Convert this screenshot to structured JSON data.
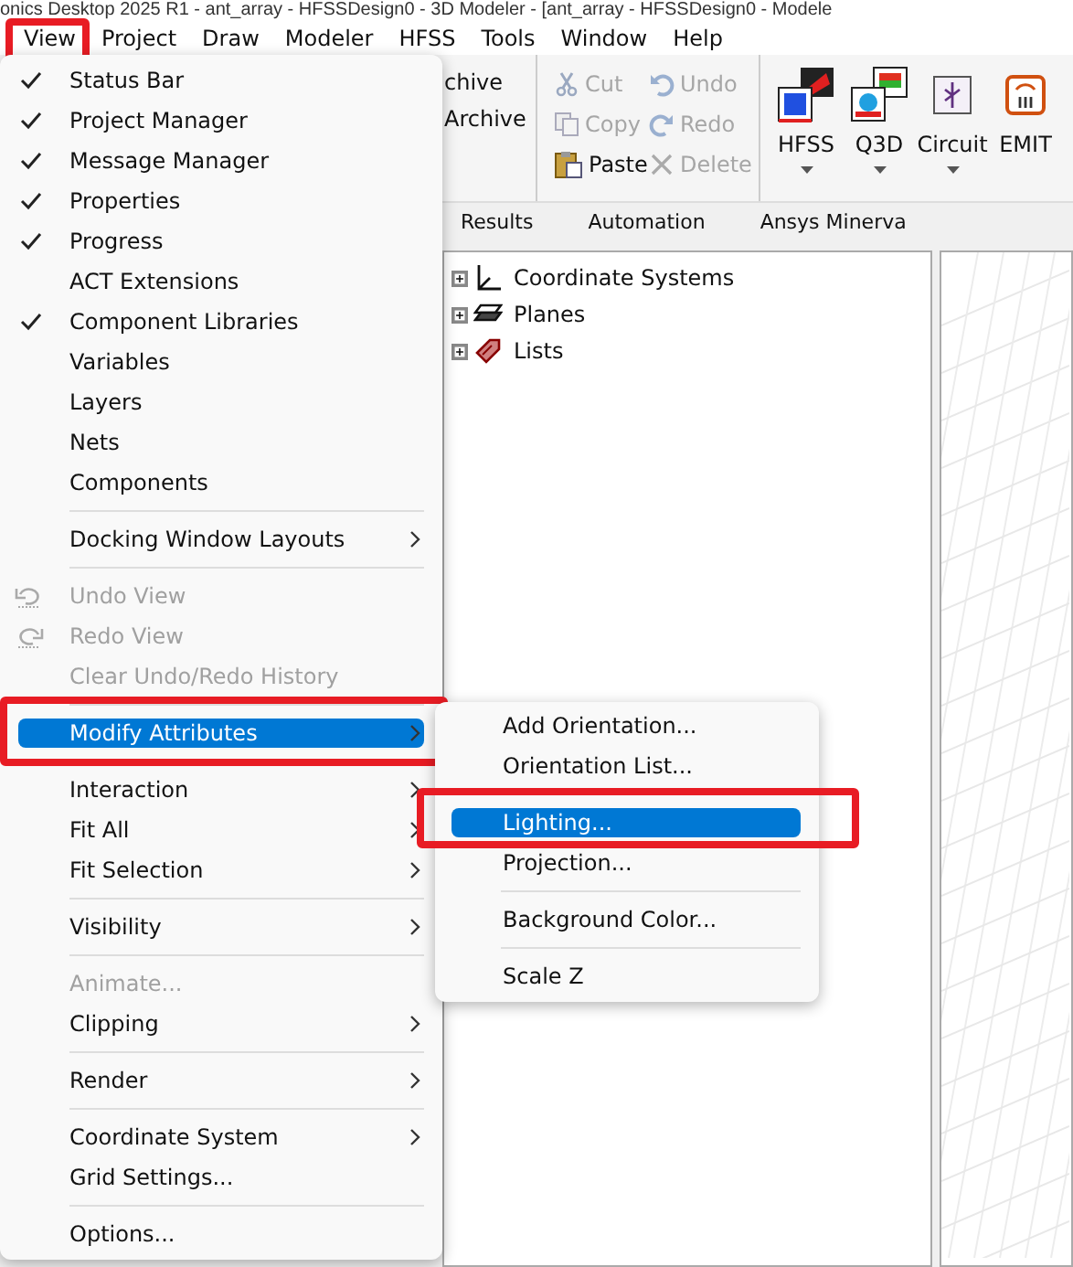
{
  "window": {
    "title": "onics Desktop 2025 R1 - ant_array - HFSSDesign0 - 3D Modeler - [ant_array - HFSSDesign0 - Modele"
  },
  "menubar": [
    {
      "label": "View",
      "open": true,
      "marked": true
    },
    {
      "label": "Project",
      "open": false,
      "marked": false
    },
    {
      "label": "Draw",
      "open": false,
      "marked": false
    },
    {
      "label": "Modeler",
      "open": false,
      "marked": false
    },
    {
      "label": "HFSS",
      "open": false,
      "marked": false
    },
    {
      "label": "Tools",
      "open": false,
      "marked": false
    },
    {
      "label": "Window",
      "open": false,
      "marked": false
    },
    {
      "label": "Help",
      "open": false,
      "marked": false
    }
  ],
  "ribbon": {
    "file_group": [
      "chive",
      "Archive"
    ],
    "edit_group": [
      {
        "kind": "cut",
        "label": "Cut",
        "disabled": true
      },
      {
        "kind": "copy",
        "label": "Copy",
        "disabled": true
      },
      {
        "kind": "paste",
        "label": "Paste",
        "disabled": false
      },
      {
        "kind": "undo",
        "label": "Undo",
        "disabled": true
      },
      {
        "kind": "redo",
        "label": "Redo",
        "disabled": true
      },
      {
        "kind": "delete",
        "label": "Delete",
        "disabled": true
      }
    ],
    "design_buttons": [
      {
        "kind": "hfss",
        "label": "HFSS",
        "dropdown": true
      },
      {
        "kind": "q3d",
        "label": "Q3D",
        "dropdown": true
      },
      {
        "kind": "circuit",
        "label": "Circuit",
        "dropdown": true
      },
      {
        "kind": "emit",
        "label": "EMIT",
        "dropdown": false
      }
    ],
    "tabs": [
      "Results",
      "Automation",
      "Ansys Minerva"
    ]
  },
  "tree": {
    "items": [
      {
        "kind": "coordinate",
        "label": "Coordinate Systems",
        "expanded": false
      },
      {
        "kind": "planes",
        "label": "Planes",
        "expanded": false
      },
      {
        "kind": "lists",
        "label": "Lists",
        "expanded": false
      }
    ]
  },
  "view_menu": {
    "items": [
      {
        "kind": "item",
        "label": "Status Bar",
        "checked": true,
        "disabled": false,
        "submenu": false,
        "selected": false
      },
      {
        "kind": "item",
        "label": "Project Manager",
        "checked": true,
        "disabled": false,
        "submenu": false,
        "selected": false
      },
      {
        "kind": "item",
        "label": "Message Manager",
        "checked": true,
        "disabled": false,
        "submenu": false,
        "selected": false
      },
      {
        "kind": "item",
        "label": "Properties",
        "checked": true,
        "disabled": false,
        "submenu": false,
        "selected": false
      },
      {
        "kind": "item",
        "label": "Progress",
        "checked": true,
        "disabled": false,
        "submenu": false,
        "selected": false
      },
      {
        "kind": "item",
        "label": "ACT Extensions",
        "checked": false,
        "disabled": false,
        "submenu": false,
        "selected": false
      },
      {
        "kind": "item",
        "label": "Component Libraries",
        "checked": true,
        "disabled": false,
        "submenu": false,
        "selected": false
      },
      {
        "kind": "item",
        "label": "Variables",
        "checked": false,
        "disabled": false,
        "submenu": false,
        "selected": false
      },
      {
        "kind": "item",
        "label": "Layers",
        "checked": false,
        "disabled": false,
        "submenu": false,
        "selected": false
      },
      {
        "kind": "item",
        "label": "Nets",
        "checked": false,
        "disabled": false,
        "submenu": false,
        "selected": false
      },
      {
        "kind": "item",
        "label": "Components",
        "checked": false,
        "disabled": false,
        "submenu": false,
        "selected": false
      },
      {
        "kind": "separator"
      },
      {
        "kind": "item",
        "label": "Docking Window Layouts",
        "checked": false,
        "disabled": false,
        "submenu": true,
        "selected": false
      },
      {
        "kind": "separator"
      },
      {
        "kind": "undo",
        "label": "Undo View",
        "checked": false,
        "disabled": true,
        "submenu": false,
        "selected": false
      },
      {
        "kind": "redo",
        "label": "Redo View",
        "checked": false,
        "disabled": true,
        "submenu": false,
        "selected": false
      },
      {
        "kind": "item",
        "label": "Clear Undo/Redo History",
        "checked": false,
        "disabled": true,
        "submenu": false,
        "selected": false
      },
      {
        "kind": "separator"
      },
      {
        "kind": "item",
        "label": "Modify Attributes",
        "checked": false,
        "disabled": false,
        "submenu": true,
        "selected": true,
        "marked": true
      },
      {
        "kind": "separator"
      },
      {
        "kind": "item",
        "label": "Interaction",
        "checked": false,
        "disabled": false,
        "submenu": true,
        "selected": false
      },
      {
        "kind": "item",
        "label": "Fit All",
        "checked": false,
        "disabled": false,
        "submenu": true,
        "selected": false
      },
      {
        "kind": "item",
        "label": "Fit Selection",
        "checked": false,
        "disabled": false,
        "submenu": true,
        "selected": false
      },
      {
        "kind": "separator"
      },
      {
        "kind": "item",
        "label": "Visibility",
        "checked": false,
        "disabled": false,
        "submenu": true,
        "selected": false
      },
      {
        "kind": "separator"
      },
      {
        "kind": "item",
        "label": "Animate...",
        "checked": false,
        "disabled": true,
        "submenu": false,
        "selected": false
      },
      {
        "kind": "item",
        "label": "Clipping",
        "checked": false,
        "disabled": false,
        "submenu": true,
        "selected": false
      },
      {
        "kind": "separator"
      },
      {
        "kind": "item",
        "label": "Render",
        "checked": false,
        "disabled": false,
        "submenu": true,
        "selected": false
      },
      {
        "kind": "separator"
      },
      {
        "kind": "item",
        "label": "Coordinate System",
        "checked": false,
        "disabled": false,
        "submenu": true,
        "selected": false
      },
      {
        "kind": "item",
        "label": "Grid Settings...",
        "checked": false,
        "disabled": false,
        "submenu": false,
        "selected": false
      },
      {
        "kind": "separator"
      },
      {
        "kind": "item",
        "label": "Options...",
        "checked": false,
        "disabled": false,
        "submenu": false,
        "selected": false
      }
    ]
  },
  "submenu": {
    "items": [
      {
        "kind": "item",
        "label": "Add Orientation...",
        "selected": false
      },
      {
        "kind": "item",
        "label": "Orientation List...",
        "selected": false
      },
      {
        "kind": "separator"
      },
      {
        "kind": "item",
        "label": "Lighting...",
        "selected": true,
        "marked": true
      },
      {
        "kind": "item",
        "label": "Projection...",
        "selected": false
      },
      {
        "kind": "separator"
      },
      {
        "kind": "item",
        "label": "Background Color...",
        "selected": false
      },
      {
        "kind": "separator"
      },
      {
        "kind": "item",
        "label": "Scale Z",
        "selected": false
      }
    ]
  }
}
